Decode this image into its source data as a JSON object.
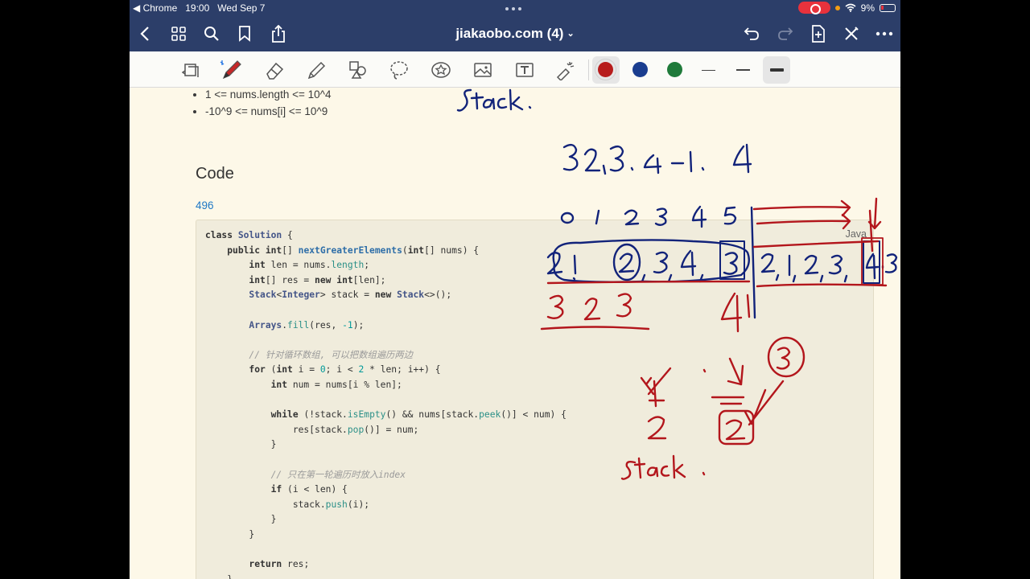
{
  "status_bar": {
    "back_app": "◀ Chrome",
    "time": "19:00",
    "date": "Wed Sep 7",
    "battery": "9%"
  },
  "nav_bar": {
    "title": "jiakaobo.com (4)",
    "icons": [
      "chevron-left-icon",
      "grid-icon",
      "search-icon",
      "bookmark-icon",
      "share-icon",
      "undo-icon",
      "redo-icon",
      "add-page-icon",
      "close-icon",
      "more-icon"
    ]
  },
  "toolbar": {
    "tools": [
      "page-scroll-icon",
      "pen-icon",
      "eraser-icon",
      "highlighter-icon",
      "shapes-icon",
      "lasso-icon",
      "sticker-icon",
      "image-icon",
      "text-icon",
      "laser-pointer-icon"
    ],
    "active_tool": "pen",
    "colors": [
      "#b71c1c",
      "#1a3d8f",
      "#1f7a3a"
    ],
    "selected_color": "#b71c1c",
    "stroke_widths": [
      "thin",
      "medium",
      "thick"
    ],
    "selected_width": "thick"
  },
  "document": {
    "constraints": [
      "1 <= nums.length <= 10^4",
      "-10^9 <= nums[i] <= 10^9"
    ],
    "section_heading": "Code",
    "problem_link": "496",
    "code_language": "Java"
  },
  "annotations": {
    "blue_stack_label": "Stack.",
    "blue_values": "3 2,3. 4 -1, 4",
    "blue_indices": "0 1 2 3 4 5",
    "blue_circled_row": "2 1 2, 3, 4, 3",
    "blue_extended_row": "2, 1, 2, 3, 4, 3",
    "red_result_left": "3 2 3",
    "red_result_boxed": "4",
    "red_stack_nums": [
      "1",
      "2"
    ],
    "red_circled": "3",
    "red_boxed": "2",
    "red_stack_label": "Stack."
  }
}
